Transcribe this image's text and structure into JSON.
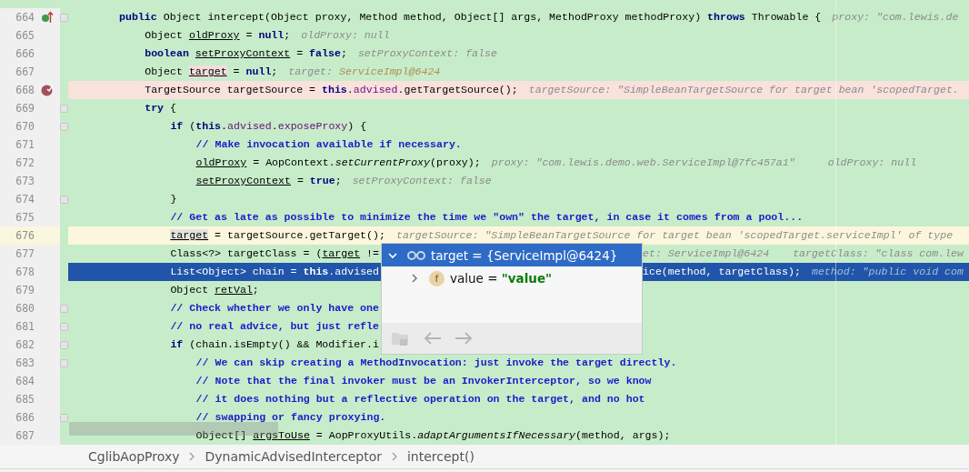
{
  "editor": {
    "lines": [
      {
        "number": "664",
        "kind": "code",
        "gutter_marker": {
          "kind": "override"
        },
        "fold": true,
        "tokens": [
          {
            "text": "public",
            "kind": "keyword"
          },
          {
            "text": " Object intercept(Object proxy, Method method, Object[] args, MethodProxy methodProxy) ",
            "kind": "plain"
          },
          {
            "text": "throws",
            "kind": "keyword"
          },
          {
            "text": " Throwable {",
            "kind": "plain"
          }
        ],
        "hints": [
          {
            "text": "proxy: \"com.lewis.de"
          }
        ],
        "children": [
          {
            "number": "665",
            "kind": "code",
            "fold": false,
            "tokens": [
              {
                "text": "Object ",
                "kind": "plain"
              },
              {
                "text": "oldProxy",
                "kind": "reassigned"
              },
              {
                "text": " = ",
                "kind": "plain"
              },
              {
                "text": "null",
                "kind": "keyword"
              },
              {
                "text": ";",
                "kind": "plain"
              }
            ],
            "hints": [
              {
                "text": "oldProxy: null"
              }
            ]
          },
          {
            "number": "666",
            "kind": "code",
            "fold": false,
            "tokens": [
              {
                "text": "boolean ",
                "kind": "keyword"
              },
              {
                "text": "setProxyContext",
                "kind": "reassigned"
              },
              {
                "text": " = ",
                "kind": "plain"
              },
              {
                "text": "false",
                "kind": "keyword"
              },
              {
                "text": ";",
                "kind": "plain"
              }
            ],
            "hints": [
              {
                "text": "setProxyContext: false"
              }
            ]
          },
          {
            "number": "667",
            "kind": "code",
            "fold": false,
            "tokens": [
              {
                "text": "Object ",
                "kind": "plain"
              },
              {
                "text": "target",
                "kind": "usage"
              },
              {
                "text": " = ",
                "kind": "plain"
              },
              {
                "text": "null",
                "kind": "keyword"
              },
              {
                "text": ";",
                "kind": "plain"
              }
            ],
            "hints": [
              {
                "text": "target: ",
                "value": "ServiceImpl@6424",
                "changed": true
              }
            ]
          },
          {
            "number": "668",
            "kind": "breakpoint",
            "gutter_marker": {
              "kind": "breakpoint"
            },
            "fold": false,
            "tokens": [
              {
                "text": "TargetSource targetSource = ",
                "kind": "plain"
              },
              {
                "text": "this",
                "kind": "keyword"
              },
              {
                "text": ".",
                "kind": "plain"
              },
              {
                "text": "advised",
                "kind": "field"
              },
              {
                "text": ".getTargetSource();",
                "kind": "plain"
              }
            ],
            "hints": [
              {
                "text": "targetSource: \"SimpleBeanTargetSource for target bean 'scopedTarget."
              }
            ]
          },
          {
            "number": "669",
            "kind": "code",
            "fold": true,
            "tokens": [
              {
                "text": "try",
                "kind": "keyword"
              },
              {
                "text": " {",
                "kind": "plain"
              }
            ],
            "children": [
              {
                "number": "670",
                "kind": "code",
                "fold": true,
                "tokens": [
                  {
                    "text": "if",
                    "kind": "keyword"
                  },
                  {
                    "text": " (",
                    "kind": "plain"
                  },
                  {
                    "text": "this",
                    "kind": "keyword"
                  },
                  {
                    "text": ".",
                    "kind": "plain"
                  },
                  {
                    "text": "advised",
                    "kind": "field"
                  },
                  {
                    "text": ".",
                    "kind": "plain"
                  },
                  {
                    "text": "exposeProxy",
                    "kind": "field"
                  },
                  {
                    "text": ") {",
                    "kind": "plain"
                  }
                ],
                "children": [
                  {
                    "number": "671",
                    "kind": "code",
                    "fold": false,
                    "tokens": [
                      {
                        "text": "// Make invocation available if necessary.",
                        "kind": "comment"
                      }
                    ]
                  },
                  {
                    "number": "672",
                    "kind": "code",
                    "fold": false,
                    "tokens": [
                      {
                        "text": "oldProxy",
                        "kind": "reassigned"
                      },
                      {
                        "text": " = AopContext.",
                        "kind": "plain"
                      },
                      {
                        "text": "setCurrentProxy",
                        "kind": "static"
                      },
                      {
                        "text": "(proxy);",
                        "kind": "plain"
                      }
                    ],
                    "hints": [
                      {
                        "text": "proxy: \"com.lewis.demo.web.ServiceImpl@7fc457a1\""
                      },
                      {
                        "text": "oldProxy: null"
                      }
                    ]
                  },
                  {
                    "number": "673",
                    "kind": "code",
                    "fold": false,
                    "tokens": [
                      {
                        "text": "setProxyContext",
                        "kind": "reassigned"
                      },
                      {
                        "text": " = ",
                        "kind": "plain"
                      },
                      {
                        "text": "true",
                        "kind": "keyword"
                      },
                      {
                        "text": ";",
                        "kind": "plain"
                      }
                    ],
                    "hints": [
                      {
                        "text": "setProxyContext: false"
                      }
                    ]
                  }
                ]
              },
              {
                "number": "674",
                "kind": "code",
                "fold": true,
                "tokens": [
                  {
                    "text": "}",
                    "kind": "plain"
                  }
                ]
              },
              {
                "number": "675",
                "kind": "code",
                "fold": false,
                "tokens": [
                  {
                    "text": "// Get as late as possible to minimize the time we \"own\" the target, in case it comes from a pool...",
                    "kind": "comment"
                  }
                ]
              },
              {
                "number": "676",
                "kind": "caret",
                "fold": false,
                "tokens": [
                  {
                    "text": "target",
                    "kind": "caret_usage"
                  },
                  {
                    "text": " = targetSource.getTarget();",
                    "kind": "plain"
                  }
                ],
                "hints": [
                  {
                    "text": "targetSource: \"SimpleBeanTargetSource for target bean 'scopedTarget.serviceImpl' of type"
                  }
                ]
              },
              {
                "number": "677",
                "kind": "code",
                "fold": false,
                "tokens": [
                  {
                    "text": "Class<?> targetClass = (",
                    "kind": "plain"
                  },
                  {
                    "text": "target",
                    "kind": "reassigned"
                  },
                  {
                    "text": " !=",
                    "kind": "plain"
                  }
                ],
                "after_popup": {
                  "hints": [
                    {
                      "text": "et: ServiceImpl@6424"
                    },
                    {
                      "text": "targetClass: \"class com.lew"
                    }
                  ]
                }
              },
              {
                "number": "678",
                "kind": "execution",
                "fold": false,
                "tokens": [
                  {
                    "text": "List<Object> chain = ",
                    "kind": "plain"
                  },
                  {
                    "text": "this",
                    "kind": "keyword"
                  },
                  {
                    "text": ".",
                    "kind": "plain"
                  },
                  {
                    "text": "advised",
                    "kind": "field"
                  }
                ],
                "after_popup": {
                  "tokens": [
                    {
                      "text": "ice(method, targetClass);",
                      "kind": "plain"
                    }
                  ],
                  "hints": [
                    {
                      "text": "method: \"public void com"
                    }
                  ]
                }
              },
              {
                "number": "679",
                "kind": "code",
                "fold": false,
                "tokens": [
                  {
                    "text": "Object ",
                    "kind": "plain"
                  },
                  {
                    "text": "retVal",
                    "kind": "reassigned"
                  },
                  {
                    "text": ";",
                    "kind": "plain"
                  }
                ]
              },
              {
                "number": "680",
                "kind": "code",
                "fold": true,
                "tokens": [
                  {
                    "text": "// Check whether we only have one",
                    "kind": "comment"
                  }
                ]
              },
              {
                "number": "681",
                "kind": "code",
                "fold": true,
                "tokens": [
                  {
                    "text": "// no real advice, but just refle",
                    "kind": "comment"
                  }
                ]
              },
              {
                "number": "682",
                "kind": "code",
                "fold": true,
                "tokens": [
                  {
                    "text": "if",
                    "kind": "keyword"
                  },
                  {
                    "text": " (chain.isEmpty() && Modifier.i",
                    "kind": "plain"
                  }
                ],
                "children": [
                  {
                    "number": "683",
                    "kind": "code",
                    "fold": true,
                    "tokens": [
                      {
                        "text": "// We can skip creating a MethodInvocation: just invoke the target directly.",
                        "kind": "comment"
                      }
                    ]
                  },
                  {
                    "number": "684",
                    "kind": "code",
                    "fold": false,
                    "tokens": [
                      {
                        "text": "// Note that the final invoker must be an InvokerInterceptor, so we know",
                        "kind": "comment"
                      }
                    ]
                  },
                  {
                    "number": "685",
                    "kind": "code",
                    "fold": false,
                    "tokens": [
                      {
                        "text": "// it does nothing but a reflective operation on the target, and no hot",
                        "kind": "comment"
                      }
                    ]
                  },
                  {
                    "number": "686",
                    "kind": "code",
                    "fold": true,
                    "tokens": [
                      {
                        "text": "// swapping or fancy proxying.",
                        "kind": "comment"
                      }
                    ]
                  },
                  {
                    "number": "687",
                    "kind": "code",
                    "fold": false,
                    "tokens": [
                      {
                        "text": "Object[] ",
                        "kind": "plain"
                      },
                      {
                        "text": "argsToUse",
                        "kind": "reassigned"
                      },
                      {
                        "text": " = AopProxyUtils.",
                        "kind": "plain"
                      },
                      {
                        "text": "adaptArgumentsIfNecessary",
                        "kind": "static"
                      },
                      {
                        "text": "(method, args);",
                        "kind": "plain"
                      }
                    ]
                  }
                ]
              }
            ]
          }
        ]
      }
    ]
  },
  "popup": {
    "expanded": true,
    "title": "target = {ServiceImpl@6424}",
    "children": [
      {
        "expanded": false,
        "badge": "f",
        "name": "value = ",
        "value": "\"value\""
      }
    ]
  },
  "breadcrumbs": [
    "CglibAopProxy",
    "DynamicAdvisedInterceptor",
    "intercept()"
  ]
}
